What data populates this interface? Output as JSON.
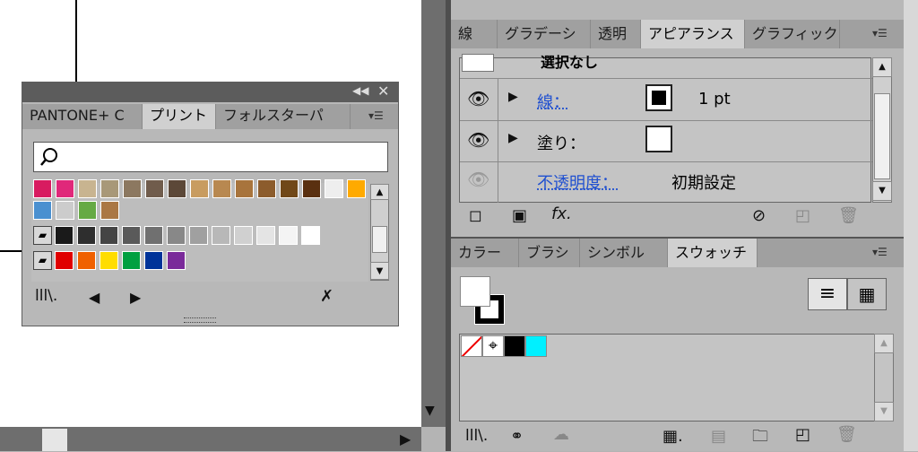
{
  "swatch_panel_float": {
    "tabs": [
      "PANTONE+ C",
      "プリント",
      "フォルスターパ"
    ],
    "collapse_icon": "double-chevron-left-icon",
    "close_icon": "close-icon",
    "search_placeholder": "",
    "colors": {
      "row1": [
        "#d81b60",
        "#e0287a",
        "#c8b490",
        "#a89878",
        "#8c7860",
        "#705c4c",
        "#5c4838",
        "#c89c60",
        "#b88850",
        "#a8743c",
        "#8c5c2c",
        "#704818",
        "#5a3010",
        "#eeeeee",
        "#ffaa00"
      ],
      "row2": [
        "#4a90d0",
        "#cccccc",
        "#66aa44",
        "#aa7744"
      ],
      "row3": [
        "#1a1a1a",
        "#2e2e2e",
        "#444444",
        "#5a5a5a",
        "#707070",
        "#888888",
        "#a0a0a0",
        "#b8b8b8",
        "#d0d0d0",
        "#e4e4e4",
        "#f4f4f4",
        "#ffffff"
      ],
      "row4": [
        "#e00000",
        "#f06000",
        "#ffdd00",
        "#00a040",
        "#003399",
        "#7a2a9a"
      ]
    }
  },
  "appearance_panel": {
    "tabs": [
      "線",
      "グラデーシ",
      "透明",
      "アピアランス",
      "グラフィック"
    ],
    "header_text": "選択なし",
    "rows": [
      {
        "label": "線：",
        "value": "1 pt"
      },
      {
        "label": "塗り："
      },
      {
        "label": "不透明度：",
        "value": "初期設定"
      }
    ]
  },
  "swatches_panel": {
    "tabs": [
      "カラー",
      "ブラシ",
      "シンボル",
      "スウォッチ"
    ]
  }
}
